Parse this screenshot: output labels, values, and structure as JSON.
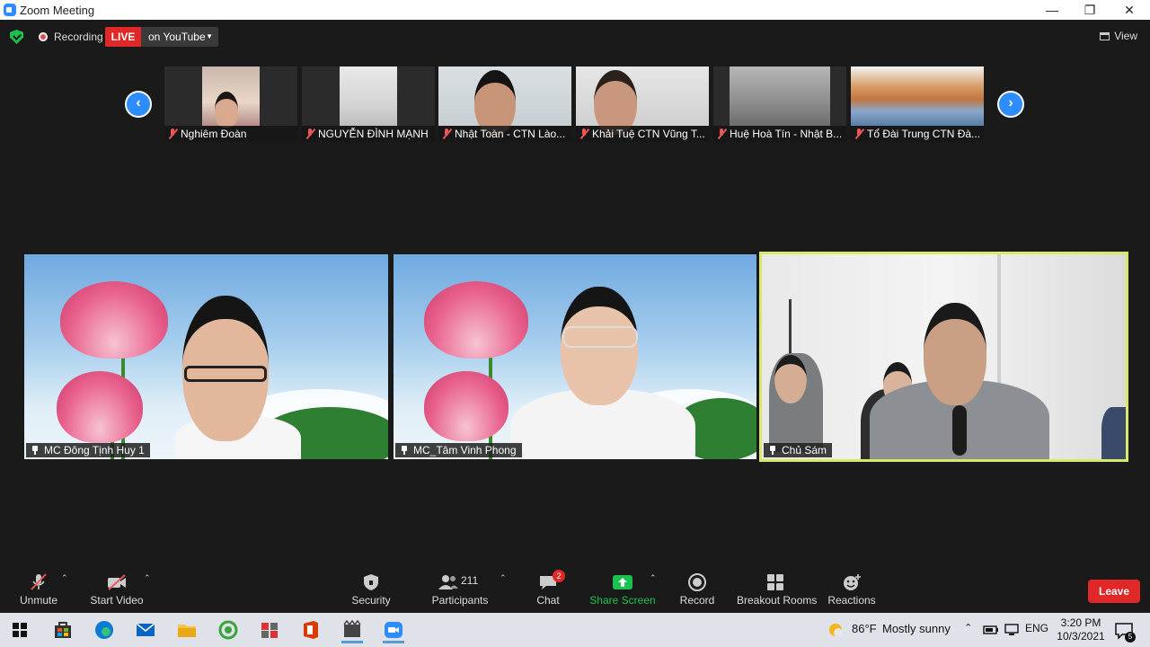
{
  "window": {
    "title": "Zoom Meeting",
    "minimize": "—",
    "restore": "❐",
    "close": "✕"
  },
  "meeting_bar": {
    "recording_label": "Recording",
    "live_label": "LIVE",
    "stream_target": "on YouTube",
    "view_label": "View"
  },
  "thumbnails": [
    {
      "name": "Nghiêm Đoàn"
    },
    {
      "name": "NGUYỄN ĐÌNH MẠNH"
    },
    {
      "name": "Nhật Toàn - CTN Lào..."
    },
    {
      "name": "Khải Tuệ CTN Vũng T..."
    },
    {
      "name": "Huệ Hoà Tín - Nhật B..."
    },
    {
      "name": "Tổ Đài Trung CTN Đà..."
    }
  ],
  "main_tiles": [
    {
      "name": "MC Đông Tịnh Huy 1",
      "active": false
    },
    {
      "name": "MC_Tâm Vinh Phong",
      "active": false
    },
    {
      "name": "Chủ Sám",
      "active": true
    }
  ],
  "toolbar": {
    "unmute": "Unmute",
    "start_video": "Start Video",
    "security": "Security",
    "participants": "Participants",
    "participants_count": "211",
    "chat": "Chat",
    "chat_badge": "2",
    "share_screen": "Share Screen",
    "record": "Record",
    "breakout_rooms": "Breakout Rooms",
    "reactions": "Reactions",
    "leave": "Leave"
  },
  "taskbar": {
    "weather_temp": "86°F",
    "weather_desc": "Mostly sunny",
    "language": "ENG",
    "time": "3:20 PM",
    "date": "10/3/2021",
    "notification_count": "5"
  },
  "colors": {
    "accent": "#2d8cff",
    "live": "#e02828",
    "active_border": "#d9e86a",
    "share_green": "#1bc14e"
  }
}
